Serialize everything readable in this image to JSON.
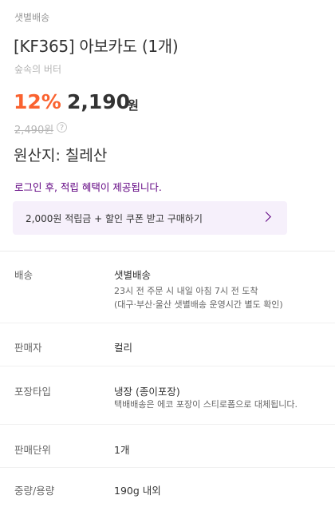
{
  "product": {
    "delivery_type": "샛별배송",
    "name": "[KF365] 아보카도 (1개)",
    "subtitle": "숲속의 버터",
    "discount": "12%",
    "price": "2,190",
    "currency": "원",
    "original_price": "2,490원",
    "info_icon": "?",
    "origin": "원산지: 칠레산"
  },
  "notice": {
    "login": "로그인 후, 적립 혜택이 제공됩니다."
  },
  "coupon": {
    "label": "2,000원 적립금 + 할인 쿠폰 받고 구매하기",
    "icon": "chevron-right-icon"
  },
  "details": [
    {
      "label": "배송",
      "value": "샛별배송",
      "desc": [
        "23시 전 주문 시 내일 아침 7시 전 도착",
        "(대구·부산·울산 샛별배송 운영시간 별도 확인)"
      ]
    },
    {
      "label": "판매자",
      "value": "컬리",
      "desc": []
    },
    {
      "label": "포장타입",
      "value": "냉장 (종이포장)",
      "desc": [
        "택배배송은 에코 포장이 스티로폼으로 대체됩니다."
      ]
    },
    {
      "label": "판매단위",
      "value": "1개",
      "desc": []
    },
    {
      "label": "중량/용량",
      "value": "190g 내외",
      "desc": []
    }
  ],
  "colors": {
    "accent": "#5f0080",
    "discount": "#fa622f",
    "coupon_bg": "#f6f0fb"
  }
}
